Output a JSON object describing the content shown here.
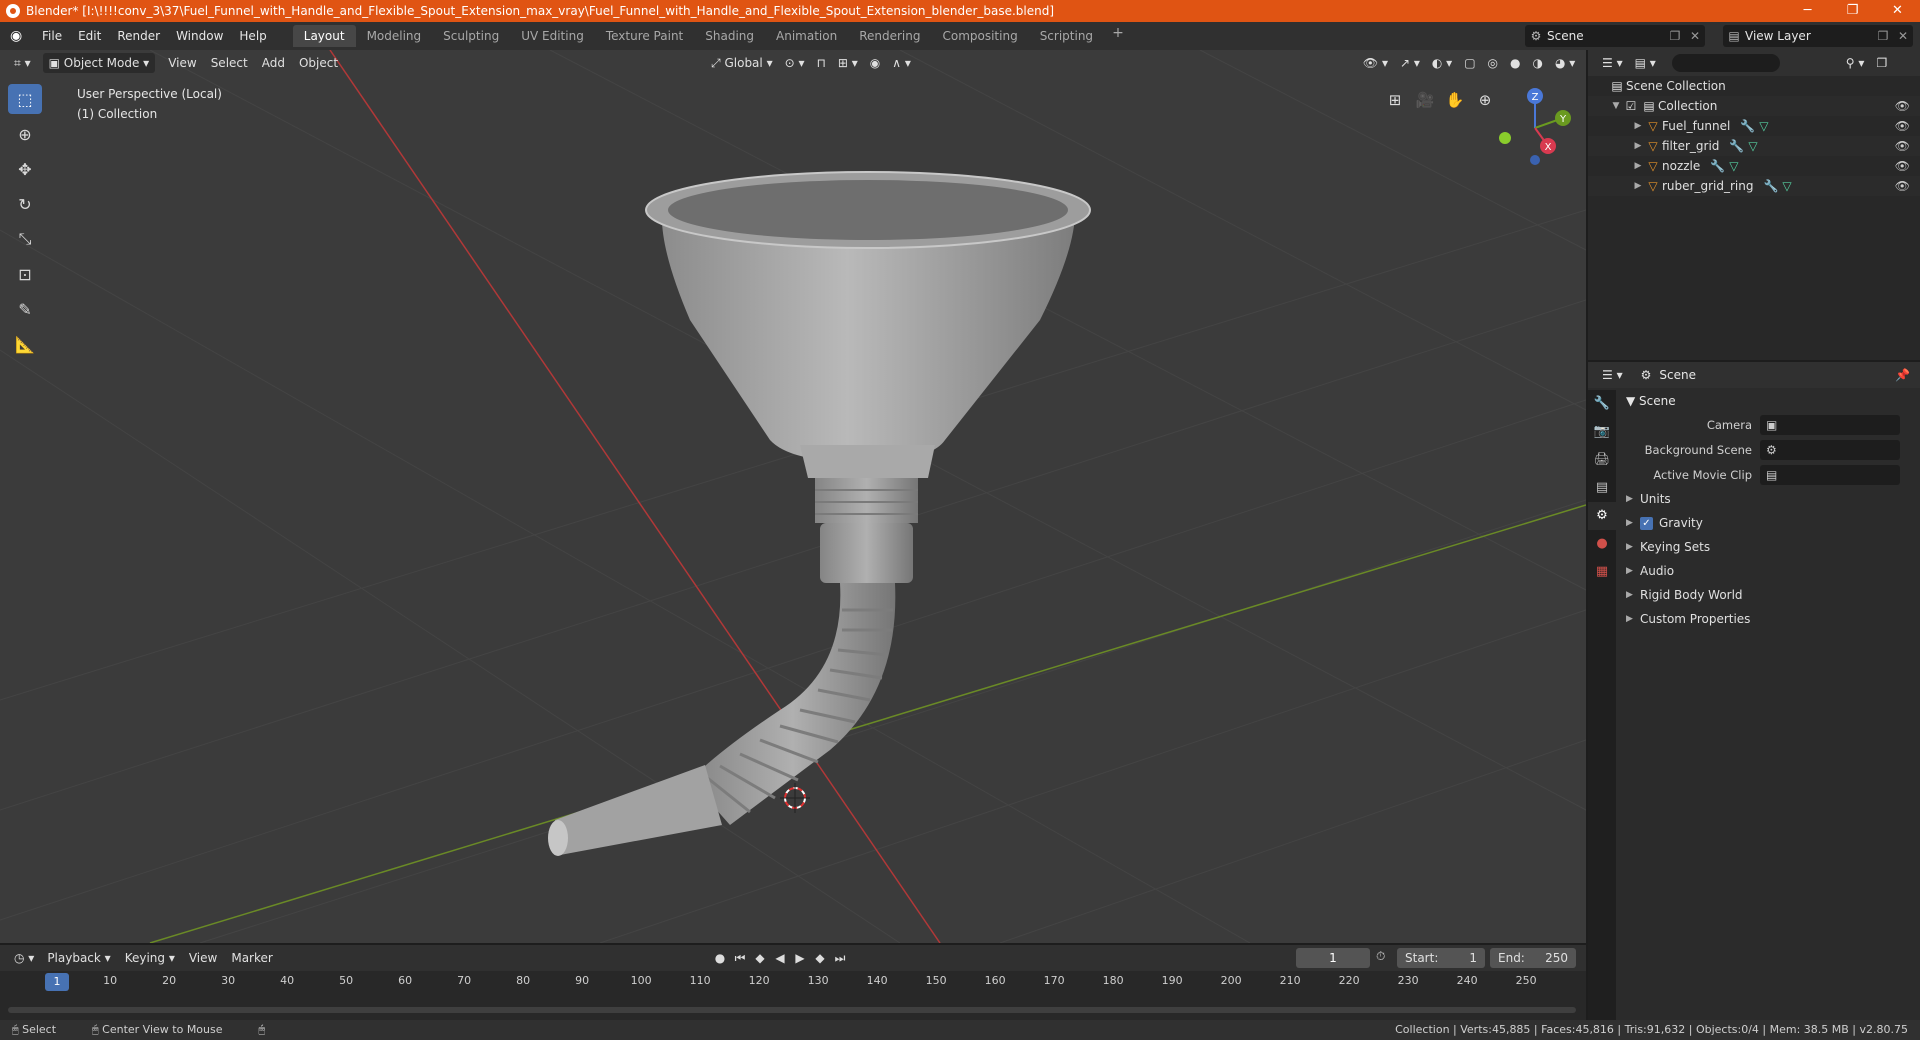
{
  "window": {
    "title": "Blender* [I:\\!!!!conv_3\\37\\Fuel_Funnel_with_Handle_and_Flexible_Spout_Extension_max_vray\\Fuel_Funnel_with_Handle_and_Flexible_Spout_Extension_blender_base.blend]",
    "minimize": "─",
    "maximize": "❐",
    "close": "✕"
  },
  "menubar": {
    "items": [
      "File",
      "Edit",
      "Render",
      "Window",
      "Help"
    ],
    "workspaces": [
      "Layout",
      "Modeling",
      "Sculpting",
      "UV Editing",
      "Texture Paint",
      "Shading",
      "Animation",
      "Rendering",
      "Compositing",
      "Scripting"
    ],
    "active_workspace": "Layout",
    "add_tab": "+",
    "scene": "Scene",
    "view_layer": "View Layer"
  },
  "viewport": {
    "mode": "Object Mode",
    "menus": [
      "View",
      "Select",
      "Add",
      "Object"
    ],
    "transform_orientation": "Global",
    "info_line1": "User Perspective (Local)",
    "info_line2": "(1) Collection",
    "gizmo_labels": {
      "x": "X",
      "y": "Y",
      "z": "Z"
    }
  },
  "outliner": {
    "search_placeholder": "",
    "root": "Scene Collection",
    "collection": "Collection",
    "objects": [
      "Fuel_funnel",
      "filter_grid",
      "nozzle",
      "ruber_grid_ring"
    ]
  },
  "properties": {
    "context": "Scene",
    "panel": "Scene",
    "fields": [
      {
        "label": "Camera",
        "value": ""
      },
      {
        "label": "Background Scene",
        "value": ""
      },
      {
        "label": "Active Movie Clip",
        "value": ""
      }
    ],
    "subpanels": [
      "Units",
      "Gravity",
      "Keying Sets",
      "Audio",
      "Rigid Body World",
      "Custom Properties"
    ],
    "gravity_checked": true
  },
  "timeline": {
    "menus": [
      "Playback",
      "Keying",
      "View",
      "Marker"
    ],
    "current_frame": "1",
    "start_label": "Start:",
    "start": "1",
    "end_label": "End:",
    "end": "250",
    "ticks": [
      "10",
      "20",
      "30",
      "40",
      "50",
      "60",
      "70",
      "80",
      "90",
      "100",
      "110",
      "120",
      "130",
      "140",
      "150",
      "160",
      "170",
      "180",
      "190",
      "200",
      "210",
      "220",
      "230",
      "240",
      "250"
    ]
  },
  "statusbar": {
    "select": "Select",
    "center_view": "Center View to Mouse",
    "stats": "Collection | Verts:45,885 | Faces:45,816 | Tris:91,632 | Objects:0/4 | Mem: 38.5 MB | v2.80.75"
  }
}
